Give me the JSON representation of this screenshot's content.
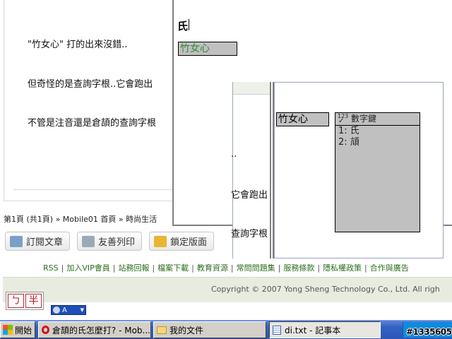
{
  "forum": {
    "post_lines": [
      "\"竹女心\" 打的出來沒錯..",
      "但奇怪的是查詢字根..它會跑出",
      "不管是注音還是倉頡的查詢字根"
    ],
    "breadcrumb": "第1頁 (共1頁) » Mobile01 首頁 » 時尚生活",
    "buttons": {
      "subscribe": "訂閱文章",
      "print": "友善列印",
      "lock": "鎖定版面"
    },
    "footer_links": [
      "RSS",
      "加入VIP會員",
      "站務回報",
      "檔案下載",
      "教育資源",
      "常問問題集",
      "服務條款",
      "隱私權政策",
      "合作與廣告"
    ],
    "copyright": "Copyright © 2007 Yong Sheng Technology Co., Ltd. All righ"
  },
  "notepad": {
    "typed_char": "氏",
    "composition": "竹女心"
  },
  "ghost": {
    "lines": [
      "..",
      "它會跑出",
      "查詢字根"
    ]
  },
  "ime_panel": {
    "input_roots": "竹女心",
    "candidate_header_num": "123",
    "candidate_header_tick": "✓",
    "candidate_header": "數字鍵",
    "candidates": [
      "1: 氏",
      "2: 頏"
    ]
  },
  "ime_toolbar": {
    "key1": "ㄅ",
    "key2": "半",
    "lang_label": "A",
    "arrow": "▼"
  },
  "taskbar": {
    "start_label": "開始",
    "tasks": [
      "倉頡的氏怎麼打? - Mob...",
      "我的文件",
      "di.txt - 記事本"
    ]
  },
  "stamp": "#1335605",
  "colors": {
    "taskbar_blue": "#2c56b8",
    "link_green": "#2b6e1e",
    "composition_green": "#2e8b2e",
    "ime_key_red": "#c1121f"
  }
}
